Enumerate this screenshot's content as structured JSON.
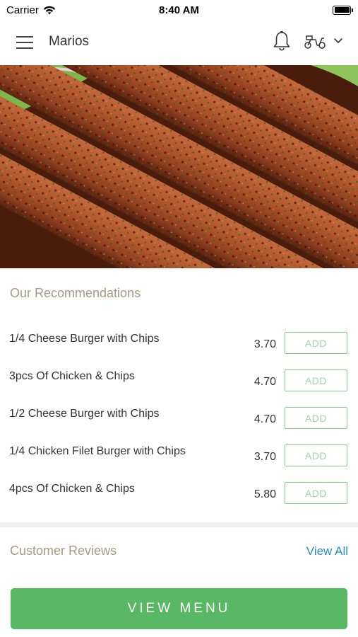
{
  "status_bar": {
    "carrier": "Carrier",
    "time": "8:40 AM"
  },
  "header": {
    "title": "Marios",
    "icons": {
      "menu": "hamburger-icon",
      "notifications": "bell-icon",
      "delivery": "scooter-icon",
      "dropdown": "chevron-down-icon"
    }
  },
  "hero": {
    "description": "grilled seekh kebabs"
  },
  "recommendations": {
    "title": "Our Recommendations",
    "items": [
      {
        "name": "1/4 Cheese Burger with Chips",
        "price": "3.70",
        "button": "ADD"
      },
      {
        "name": "3pcs Of Chicken & Chips",
        "price": "4.70",
        "button": "ADD"
      },
      {
        "name": "1/2 Cheese Burger with Chips",
        "price": "4.70",
        "button": "ADD"
      },
      {
        "name": "1/4 Chicken Filet Burger with Chips",
        "price": "3.70",
        "button": "ADD"
      },
      {
        "name": "4pcs Of Chicken & Chips",
        "price": "5.80",
        "button": "ADD"
      }
    ]
  },
  "reviews": {
    "title": "Customer Reviews",
    "view_all": "View All"
  },
  "footer": {
    "view_menu": "VIEW MENU"
  },
  "colors": {
    "accent_green": "#58b864",
    "link_blue": "#2a8fbd",
    "section_title": "#a89a7e"
  }
}
